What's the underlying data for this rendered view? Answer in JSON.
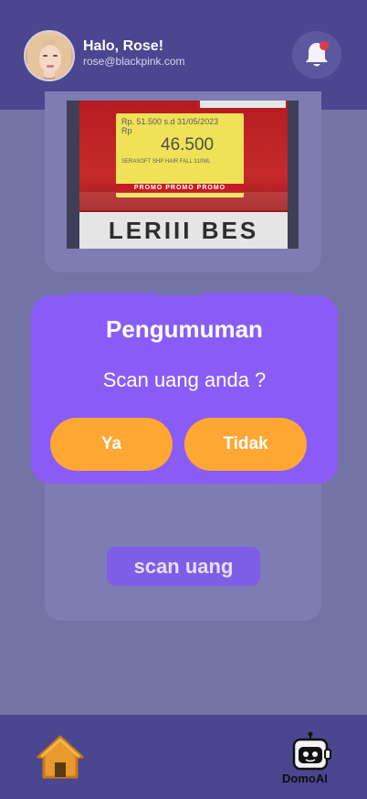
{
  "header": {
    "greeting": "Halo, Rose!",
    "email": "rose@blackpink.com",
    "notification_icon": "bell-icon",
    "notification_dot_color": "#e63946"
  },
  "photo": {
    "label_old_price": "Rp. 51.500  s.d 31/05/2023",
    "label_currency": "Rp",
    "label_price": "46.500",
    "label_product": "SERASOFT SHP HAIR FALL 310ML",
    "label_promo": "PROMO  PROMO  PROMO",
    "brand_text": "LERIII BES"
  },
  "dialog": {
    "title": "Pengumuman",
    "message": "Scan uang anda ?",
    "yes_label": "Ya",
    "no_label": "Tidak"
  },
  "main": {
    "scan_button_label": "scan uang"
  },
  "bottom_nav": {
    "home_icon": "home-icon",
    "bot_icon": "robot-icon",
    "bot_label": "DomoAI"
  },
  "colors": {
    "header_bg": "#4a4690",
    "page_bg": "#7473a6",
    "dialog_bg": "#8a5cf7",
    "button_orange": "#ffa733",
    "scan_button_bg": "#7d5ee6"
  }
}
